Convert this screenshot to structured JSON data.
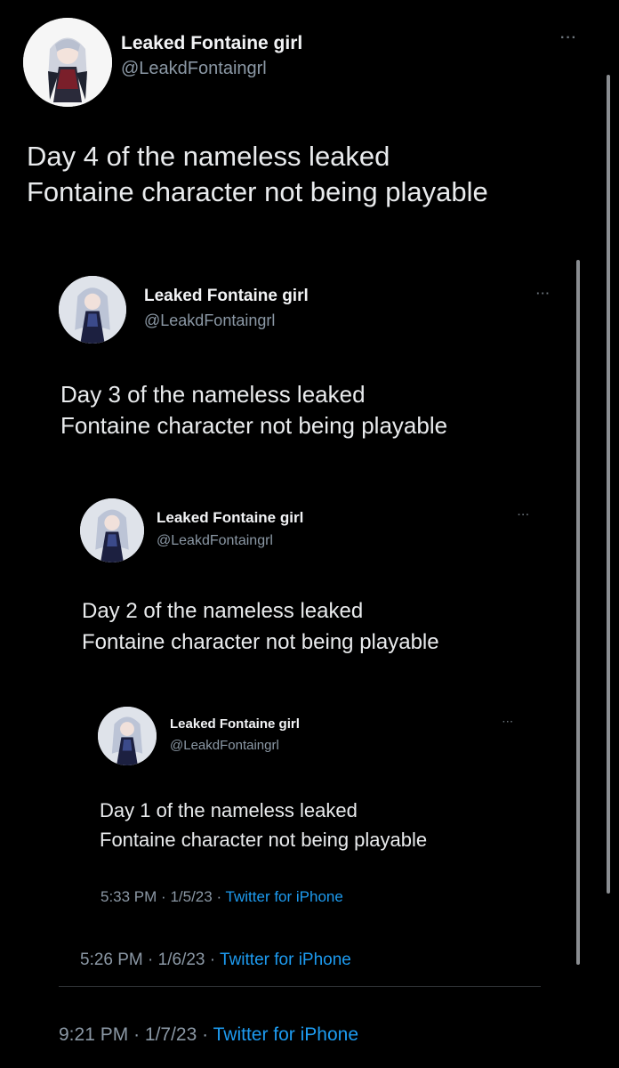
{
  "tweets": [
    {
      "name": "Leaked Fontaine girl",
      "handle": "@LeakdFontaingrl",
      "more": "···",
      "text_line1": "Day 4 of the nameless leaked",
      "text_line2": "Fontaine character not being playable",
      "time": "9:21 PM",
      "date": "1/7/23",
      "source": "Twitter for iPhone"
    },
    {
      "name": "Leaked Fontaine girl",
      "handle": "@LeakdFontaingrl",
      "more": "···",
      "text_line1": "Day 3 of the nameless leaked",
      "text_line2": "Fontaine character not being playable",
      "time": "5:26 PM",
      "date": "1/6/23",
      "source": "Twitter for iPhone"
    },
    {
      "name": "Leaked Fontaine girl",
      "handle": "@LeakdFontaingrl",
      "more": "···",
      "text_line1": "Day 2 of the nameless leaked",
      "text_line2": "Fontaine character not being playable"
    },
    {
      "name": "Leaked Fontaine girl",
      "handle": "@LeakdFontaingrl",
      "more": "···",
      "text_line1": "Day 1 of the nameless leaked",
      "text_line2": "Fontaine character not being playable",
      "time": "5:33 PM",
      "date": "1/5/23",
      "source": "Twitter for iPhone"
    }
  ],
  "meta_separator": "·",
  "icons": {
    "avatar": "anime-character-avatar-icon",
    "more": "more-options-icon"
  }
}
